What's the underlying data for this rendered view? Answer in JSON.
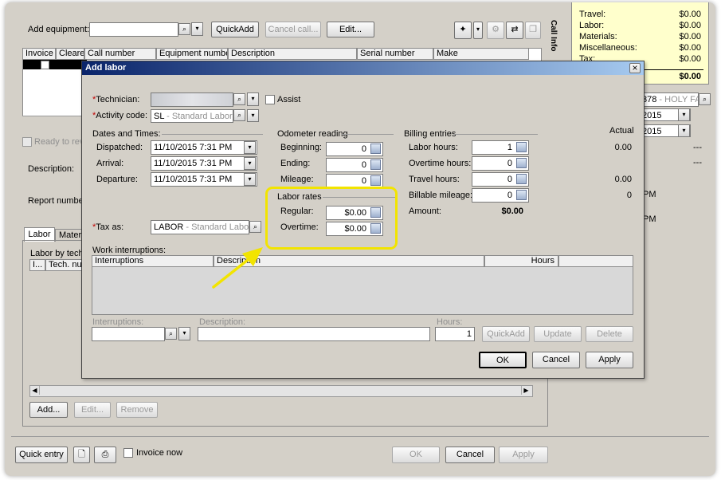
{
  "background": {
    "add_equipment_label": "Add equipment:",
    "quickadd_label": "QuickAdd",
    "cancel_call_label": "Cancel call...",
    "edit_label": "Edit...",
    "call_info_tab": "Call Info",
    "columns": [
      "Invoice",
      "Cleared",
      "Call number",
      "Equipment number",
      "Description",
      "Serial number",
      "Make"
    ],
    "ready_label": "Ready to revi",
    "description_label": "Description:",
    "report_number_label": "Report number:",
    "tabs": [
      "Labor",
      "Mater"
    ],
    "labor_by_tech_label": "Labor by techn",
    "tech_grid_cols": [
      "I...",
      "Tech. num"
    ],
    "add_label": "Add...",
    "edit2_label": "Edit...",
    "remove_label": "Remove",
    "quick_entry_label": "Quick entry",
    "invoice_now_label": "Invoice now",
    "ok_label": "OK",
    "cancel_label": "Cancel",
    "apply_label": "Apply"
  },
  "summary": {
    "rows": [
      {
        "label": "Travel:",
        "value": "$0.00"
      },
      {
        "label": "Labor:",
        "value": "$0.00"
      },
      {
        "label": "Materials:",
        "value": "$0.00"
      },
      {
        "label": "Miscellaneous:",
        "value": "$0.00"
      },
      {
        "label": "Tax:",
        "value": "$0.00"
      }
    ],
    "total": "$0.00"
  },
  "right_side": {
    "customer_value": "378",
    "customer_hint": "- HOLY FAM",
    "date1": "2015",
    "date2": "2015",
    "dash1": "---",
    "dash2": "---",
    "pm1": "PM",
    "pm2": "PM"
  },
  "dialog": {
    "title": "Add labor",
    "close": "×",
    "technician_label": "Technician:",
    "assist_label": "Assist",
    "activity_label": "Activity code:",
    "activity_code": "SL",
    "activity_hint": "- Standard Labor",
    "dates_header": "Dates and Times:",
    "dispatched_label": "Dispatched:",
    "dispatched_value": "11/10/2015  7:31 PM",
    "arrival_label": "Arrival:",
    "arrival_value": "11/10/2015  7:31 PM",
    "departure_label": "Departure:",
    "departure_value": "11/10/2015  7:31 PM",
    "taxas_label": "Tax as:",
    "taxas_code": "LABOR",
    "taxas_hint": "- Standard Labor Tax",
    "odometer_header": "Odometer reading",
    "beginning_label": "Beginning:",
    "beginning_value": "0",
    "ending_label": "Ending:",
    "ending_value": "0",
    "mileage_label": "Mileage:",
    "mileage_value": "0",
    "labor_rates_header": "Labor rates",
    "regular_label": "Regular:",
    "regular_value": "$0.00",
    "overtime_label": "Overtime:",
    "overtime_value": "$0.00",
    "billing_header": "Billing entries",
    "actual_header": "Actual",
    "labor_hours_label": "Labor hours:",
    "labor_hours_value": "1",
    "labor_hours_actual": "0.00",
    "overtime_hours_label": "Overtime hours:",
    "overtime_hours_value": "0",
    "travel_hours_label": "Travel hours:",
    "travel_hours_value": "0",
    "travel_hours_actual": "0.00",
    "billable_mileage_label": "Billable mileage:",
    "billable_mileage_value": "0",
    "billable_mileage_actual": "0",
    "amount_label": "Amount:",
    "amount_value": "$0.00",
    "work_interruptions_label": "Work interruptions:",
    "wi_columns": [
      "Interruptions",
      "Description",
      "Hours"
    ],
    "interruptions_label": "Interruptions:",
    "description_label": "Description:",
    "hours_label": "Hours:",
    "hours_value": "1",
    "quickadd_label": "QuickAdd",
    "update_label": "Update",
    "delete_label": "Delete",
    "ok_label": "OK",
    "cancel_label": "Cancel",
    "apply_label": "Apply"
  },
  "colors": {
    "highlight": "#f2e400",
    "arrow": "#f2e400",
    "title_bar": "#0a246a",
    "required": "#c00000"
  }
}
